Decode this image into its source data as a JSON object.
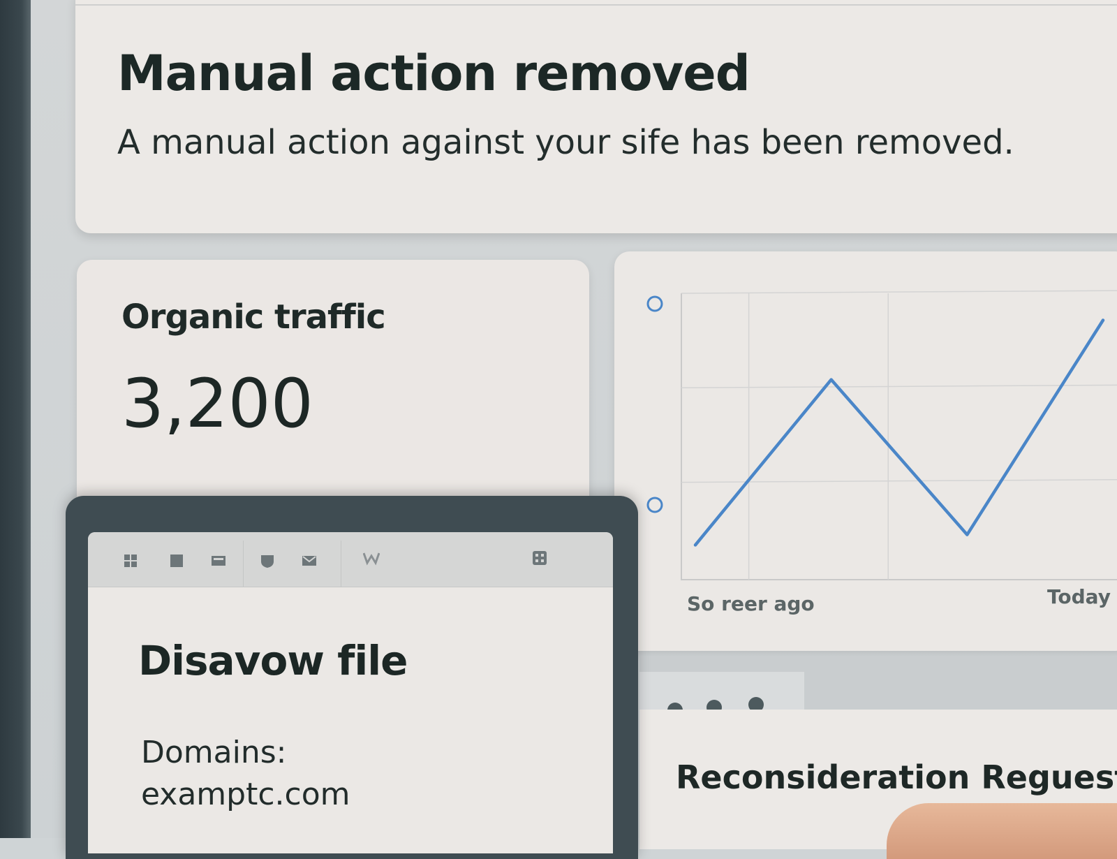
{
  "notice": {
    "title": "Manual action removed",
    "body": "A manual action against your sife has been removed."
  },
  "traffic": {
    "label": "Organic traffic",
    "value": "3,200"
  },
  "chart": {
    "x_start_label": "So reer ago",
    "x_end_label": "Today",
    "line_color": "#4a86c8"
  },
  "chart_data": {
    "type": "line",
    "x": [
      0,
      1,
      2,
      3
    ],
    "series": [
      {
        "values": [
          0.08,
          0.72,
          0.12,
          0.95
        ]
      }
    ],
    "xlabel": "",
    "ylabel": "",
    "ylim": [
      0,
      1
    ],
    "grid": true
  },
  "device": {
    "toolbar_icons": [
      "grid-icon",
      "square-icon",
      "image-icon",
      "shield-icon",
      "mail-icon",
      "w-logo-icon",
      "apps-icon"
    ],
    "title": "Disavow file",
    "domains_label": "Domains:",
    "domain_value": "examptc.com"
  },
  "reconsideration": {
    "title": "Reconsideration Reguest"
  }
}
